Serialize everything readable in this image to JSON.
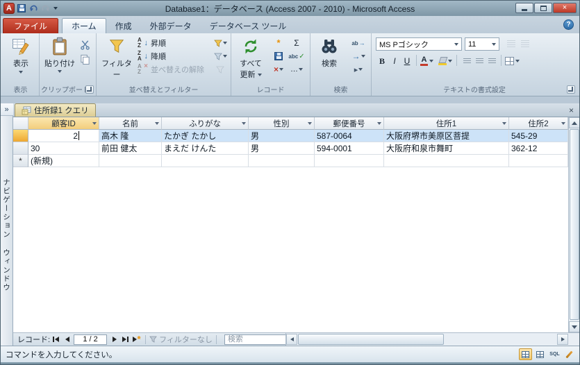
{
  "colors": {
    "titlebar": "#8FA8B7",
    "file_tab_red": "#C03A2B",
    "active_doc_tab": "#E3D79E",
    "selected_row": "#CDE3F8",
    "active_column_header": "#F6D483",
    "record_selector_editing": "#F2B13D"
  },
  "titlebar": {
    "title": "Database1：データベース (Access 2007 - 2010)  -  Microsoft Access"
  },
  "ribbon": {
    "tabs": [
      {
        "label": "ファイル"
      },
      {
        "label": "ホーム"
      },
      {
        "label": "作成"
      },
      {
        "label": "外部データ"
      },
      {
        "label": "データベース ツール"
      }
    ],
    "view_group": {
      "button": "表示",
      "label": "表示"
    },
    "clipboard_group": {
      "paste": "貼り付け",
      "label": "クリップボード"
    },
    "sort_group": {
      "filter": "フィルター",
      "ascending": "昇順",
      "descending": "降順",
      "clear_sort": "並べ替えの解除",
      "label": "並べ替えとフィルター"
    },
    "records_group": {
      "refresh_line1": "すべて",
      "refresh_line2": "更新",
      "label": "レコード"
    },
    "find_group": {
      "find": "検索",
      "label": "検索"
    },
    "text_group": {
      "font_name": "MS Pゴシック",
      "font_size": "11",
      "bold": "B",
      "italic": "I",
      "underline": "U",
      "label": "テキストの書式設定"
    }
  },
  "document": {
    "tab_title": "住所録1 クエリ",
    "table": {
      "headers": [
        "顧客ID",
        "名前",
        "ふりがな",
        "性別",
        "郵便番号",
        "住所1",
        "住所2"
      ],
      "rows": [
        {
          "id": "2",
          "name": "高木 隆",
          "kana": "たかぎ たかし",
          "gender": "男",
          "zip": "587-0064",
          "addr1": "大阪府堺市美原区菩提",
          "addr2": "545-29",
          "selected": true
        },
        {
          "id": "30",
          "name": "前田 健太",
          "kana": "まえだ けんた",
          "gender": "男",
          "zip": "594-0001",
          "addr1": "大阪府和泉市舞町",
          "addr2": "362-12",
          "selected": false
        }
      ],
      "new_row_id": "(新規)",
      "new_record_marker": "*"
    }
  },
  "navigation_pane": {
    "title": "ナビゲーション ウィンドウ",
    "expand": "»"
  },
  "record_navigator": {
    "label": "レコード:",
    "position": "1 / 2",
    "filter_status": "フィルターなし",
    "search_placeholder": "検索"
  },
  "statusbar": {
    "message": "コマンドを入力してください。",
    "sql_label": "SQL"
  },
  "icons": {
    "sigma": "Σ",
    "delete_x": "×",
    "more": "…",
    "check": "✓",
    "abc": "abc",
    "replace": "ab",
    "goto_arrow": "→",
    "select_arrow": "▸",
    "sort_a": "A",
    "sort_z": "Z",
    "arrow_down": "↓",
    "help": "?",
    "close_x": "×",
    "font_color_a": "A"
  }
}
